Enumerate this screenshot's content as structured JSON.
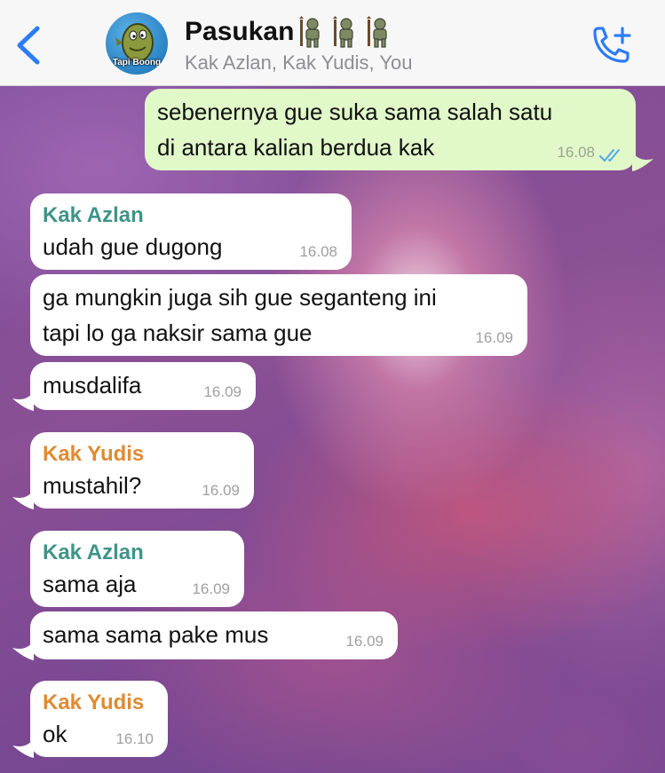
{
  "header": {
    "back_icon": "chevron-left-icon",
    "group_name": "Pasukan",
    "avatar_caption": "Tapi Boong",
    "emoji_icons": [
      "troll-emoji-icon",
      "troll-emoji-icon",
      "troll-emoji-icon"
    ],
    "members": "Kak Azlan, Kak Yudis, You",
    "call_icon": "add-call-icon"
  },
  "colors": {
    "ios_blue": "#2b7cf6",
    "outgoing_bubble": "#e1f8c9",
    "incoming_bubble": "#ffffff",
    "sender_azlan": "#3f9488",
    "sender_yudis": "#e08a33",
    "read_ticks": "#4fa9e8"
  },
  "messages": [
    {
      "direction": "out",
      "lines": [
        "sebenernya gue suka sama salah satu",
        "di antara kalian berdua kak"
      ],
      "time": "16.08",
      "status": "read"
    },
    {
      "direction": "in",
      "sender": "Kak Azlan",
      "lines": [
        "udah gue dugong"
      ],
      "time": "16.08"
    },
    {
      "direction": "in",
      "lines": [
        "ga mungkin juga sih gue seganteng ini",
        "tapi lo ga naksir sama gue"
      ],
      "time": "16.09"
    },
    {
      "direction": "in",
      "lines": [
        "musdalifa"
      ],
      "time": "16.09"
    },
    {
      "direction": "in",
      "sender": "Kak Yudis",
      "lines": [
        "mustahil?"
      ],
      "time": "16.09"
    },
    {
      "direction": "in",
      "sender": "Kak Azlan",
      "lines": [
        "sama aja"
      ],
      "time": "16.09"
    },
    {
      "direction": "in",
      "lines": [
        "sama sama pake mus"
      ],
      "time": "16.09"
    },
    {
      "direction": "in",
      "sender": "Kak Yudis",
      "lines": [
        "ok"
      ],
      "time": "16.10"
    }
  ]
}
